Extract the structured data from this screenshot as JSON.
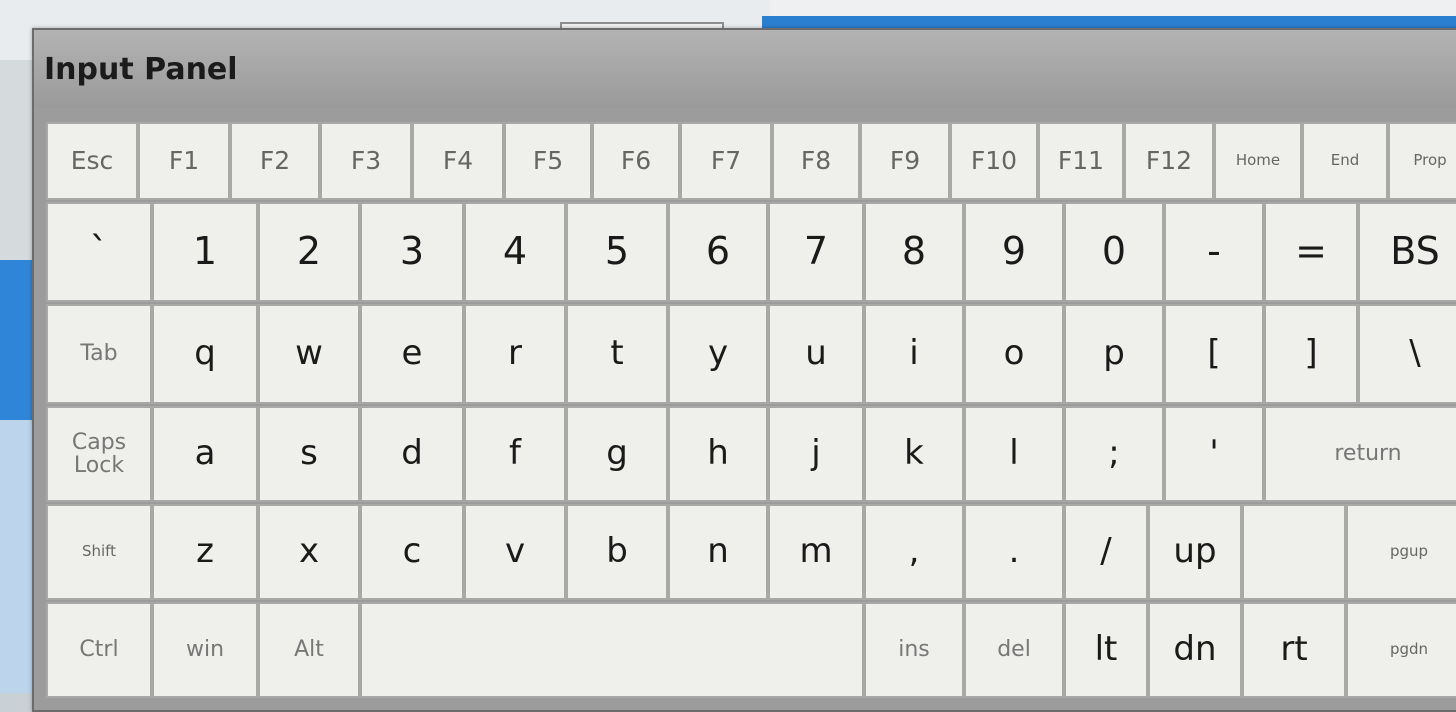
{
  "window": {
    "title": "Input Panel"
  },
  "rows": {
    "function": [
      "Esc",
      "F1",
      "F2",
      "F3",
      "F4",
      "F5",
      "F6",
      "F7",
      "F8",
      "F9",
      "F10",
      "F11",
      "F12",
      "Home",
      "End",
      "Prop"
    ],
    "number": [
      "`",
      "1",
      "2",
      "3",
      "4",
      "5",
      "6",
      "7",
      "8",
      "9",
      "0",
      "-",
      "=",
      "BS"
    ],
    "qwerty": [
      "Tab",
      "q",
      "w",
      "e",
      "r",
      "t",
      "y",
      "u",
      "i",
      "o",
      "p",
      "[",
      "]",
      "\\"
    ],
    "home": [
      "Caps Lock",
      "a",
      "s",
      "d",
      "f",
      "g",
      "h",
      "j",
      "k",
      "l",
      ";",
      "'",
      "return"
    ],
    "shift": [
      "Shift",
      "z",
      "x",
      "c",
      "v",
      "b",
      "n",
      "m",
      ",",
      ".",
      "/",
      "up",
      "",
      "pgup"
    ],
    "bottom": [
      "Ctrl",
      "win",
      "Alt",
      "",
      "ins",
      "del",
      "lt",
      "dn",
      "rt",
      "pgdn"
    ]
  },
  "colors": {
    "key_bg": "#efefeb",
    "key_border": "#a8a8a6",
    "titlebar": "#a6a6a6"
  }
}
